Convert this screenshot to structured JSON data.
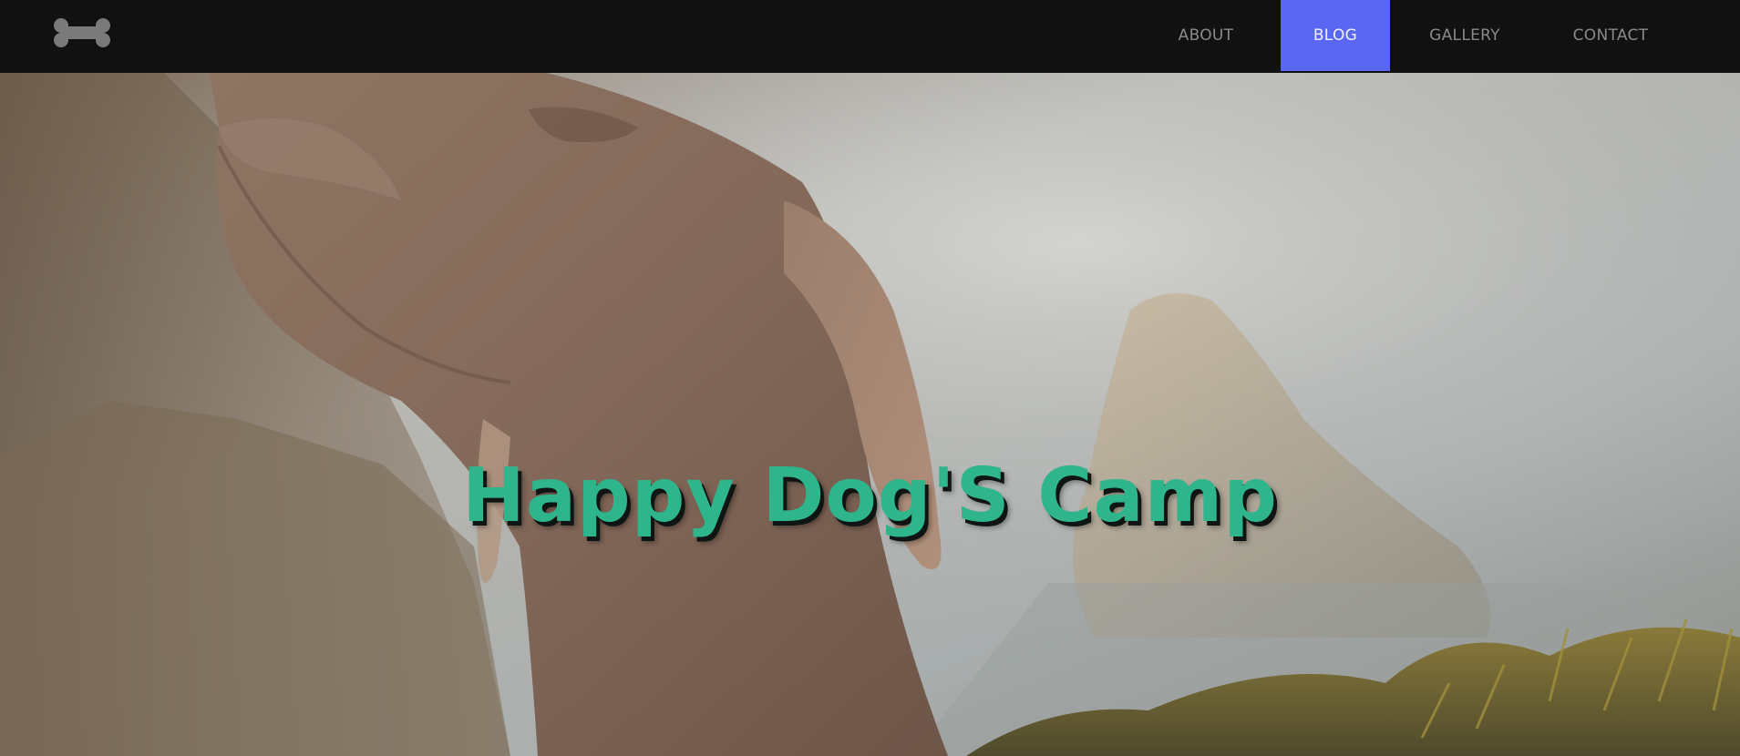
{
  "navbar": {
    "logo_icon": "bone-icon",
    "items": [
      {
        "label": "ABOUT",
        "active": false
      },
      {
        "label": "BLOG",
        "active": true
      },
      {
        "label": "GALLERY",
        "active": false
      },
      {
        "label": "CONTACT",
        "active": false
      }
    ],
    "active_color": "#5a67f2"
  },
  "hero": {
    "title": "Happy Dog'S Camp",
    "title_color": "#2fb58c"
  }
}
